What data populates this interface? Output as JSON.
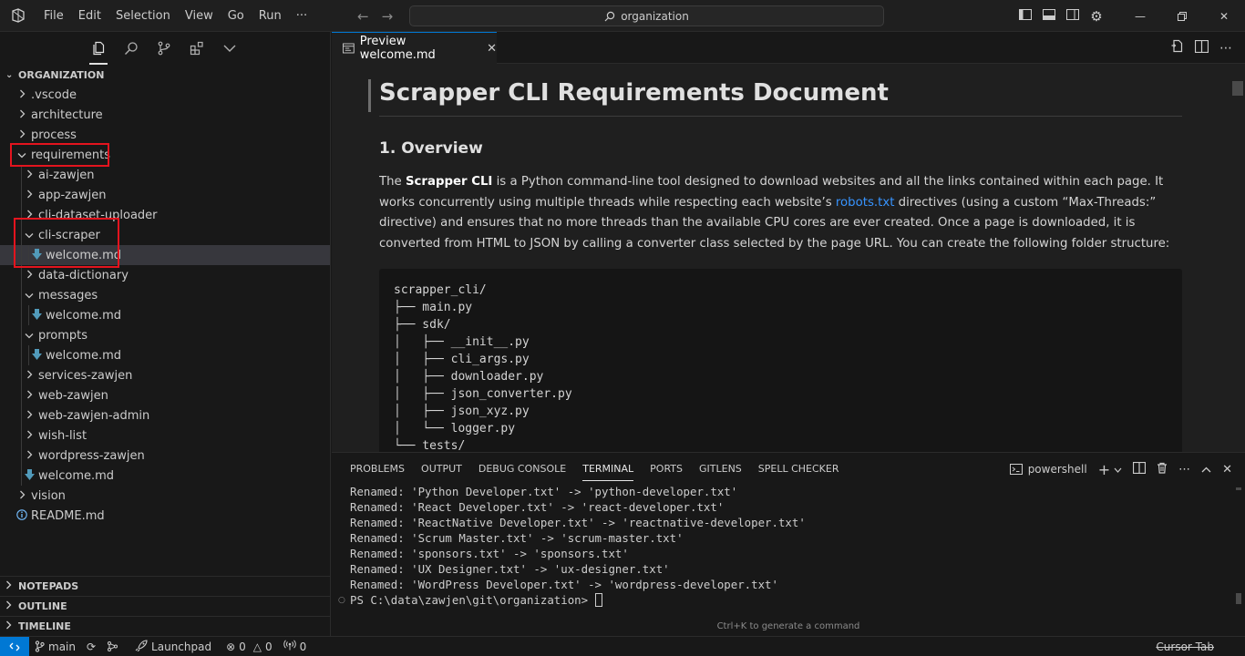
{
  "titlebar": {
    "menu": [
      "File",
      "Edit",
      "Selection",
      "View",
      "Go",
      "Run",
      "···"
    ],
    "search_text": "organization",
    "icons": [
      "toggle-primary-sidebar-icon",
      "toggle-panel-icon",
      "toggle-secondary-sidebar-icon",
      "gear-icon"
    ],
    "window_controls": [
      "minimize",
      "restore",
      "close"
    ]
  },
  "sidebar": {
    "toolbar_icons": [
      "explorer-icon",
      "search-icon",
      "source-control-icon",
      "extensions-icon",
      "more-chevron-icon"
    ],
    "root_label": "ORGANIZATION",
    "items": [
      {
        "label": ".vscode",
        "depth": 0,
        "kind": "folder",
        "open": false
      },
      {
        "label": "architecture",
        "depth": 0,
        "kind": "folder",
        "open": false
      },
      {
        "label": "process",
        "depth": 0,
        "kind": "folder",
        "open": false
      },
      {
        "label": "requirements",
        "depth": 0,
        "kind": "folder",
        "open": true
      },
      {
        "label": "ai-zawjen",
        "depth": 1,
        "kind": "folder",
        "open": false
      },
      {
        "label": "app-zawjen",
        "depth": 1,
        "kind": "folder",
        "open": false
      },
      {
        "label": "cli-dataset-uploader",
        "depth": 1,
        "kind": "folder",
        "open": false
      },
      {
        "label": "cli-scraper",
        "depth": 1,
        "kind": "folder",
        "open": true
      },
      {
        "label": "welcome.md",
        "depth": 2,
        "kind": "md",
        "selected": true
      },
      {
        "label": "data-dictionary",
        "depth": 1,
        "kind": "folder",
        "open": false
      },
      {
        "label": "messages",
        "depth": 1,
        "kind": "folder",
        "open": true
      },
      {
        "label": "welcome.md",
        "depth": 2,
        "kind": "md"
      },
      {
        "label": "prompts",
        "depth": 1,
        "kind": "folder",
        "open": true
      },
      {
        "label": "welcome.md",
        "depth": 2,
        "kind": "md"
      },
      {
        "label": "services-zawjen",
        "depth": 1,
        "kind": "folder",
        "open": false
      },
      {
        "label": "web-zawjen",
        "depth": 1,
        "kind": "folder",
        "open": false
      },
      {
        "label": "web-zawjen-admin",
        "depth": 1,
        "kind": "folder",
        "open": false
      },
      {
        "label": "wish-list",
        "depth": 1,
        "kind": "folder",
        "open": false
      },
      {
        "label": "wordpress-zawjen",
        "depth": 1,
        "kind": "folder",
        "open": false
      },
      {
        "label": "welcome.md",
        "depth": 1,
        "kind": "md"
      },
      {
        "label": "vision",
        "depth": 0,
        "kind": "folder",
        "open": false
      },
      {
        "label": "README.md",
        "depth": 0,
        "kind": "info"
      }
    ],
    "bottom_sections": [
      "NOTEPADS",
      "OUTLINE",
      "TIMELINE"
    ]
  },
  "editor": {
    "tab_label": "Preview welcome.md",
    "h1": "Scrapper CLI Requirements Document",
    "h2": "1. Overview",
    "para_before_bold": "The ",
    "para_bold": "Scrapper CLI",
    "para_mid": " is a Python command-line tool designed to download websites and all the links contained within each page. It works concurrently using multiple threads while respecting each website’s ",
    "para_link": "robots.txt",
    "para_after": " directives (using a custom “Max-Threads:” directive) and ensures that no more threads than the available CPU cores are ever created. Once a page is downloaded, it is converted from HTML to JSON by calling a converter class selected by the page URL. You can create the following folder structure:",
    "code": "scrapper_cli/\n├── main.py\n├── sdk/\n│   ├── __init__.py\n│   ├── cli_args.py\n│   ├── downloader.py\n│   ├── json_converter.py\n│   ├── json_xyz.py\n│   └── logger.py\n└── tests/"
  },
  "panel": {
    "tabs": [
      "PROBLEMS",
      "OUTPUT",
      "DEBUG CONSOLE",
      "TERMINAL",
      "PORTS",
      "GITLENS",
      "SPELL CHECKER"
    ],
    "active_tab": "TERMINAL",
    "shell_name": "powershell",
    "terminal_text": "Renamed: 'Python Developer.txt' -> 'python-developer.txt'\nRenamed: 'React Developer.txt' -> 'react-developer.txt'\nRenamed: 'ReactNative Developer.txt' -> 'reactnative-developer.txt'\nRenamed: 'Scrum Master.txt' -> 'scrum-master.txt'\nRenamed: 'sponsors.txt' -> 'sponsors.txt'\nRenamed: 'UX Designer.txt' -> 'ux-designer.txt'\nRenamed: 'WordPress Developer.txt' -> 'wordpress-developer.txt'",
    "prompt": "PS C:\\data\\zawjen\\git\\organization> ",
    "hint": "Ctrl+K to generate a command"
  },
  "statusbar": {
    "branch": "main",
    "launchpad": "Launchpad",
    "errors": "0",
    "warnings": "0",
    "ports": "0",
    "cursor_tab": "Cursor Tab"
  },
  "colors": {
    "accent": "#0078d4",
    "highlight_red": "#e3141e",
    "link": "#3794ff",
    "markdown_icon": "#519aba"
  }
}
